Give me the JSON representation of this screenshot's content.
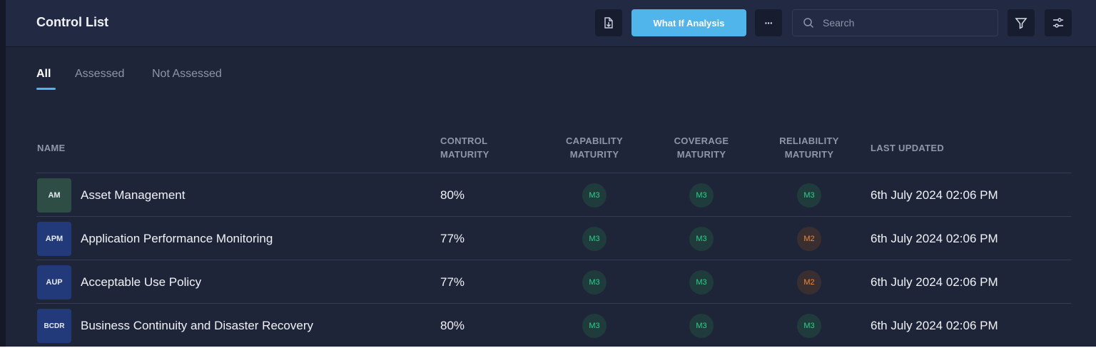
{
  "header": {
    "title": "Control List",
    "what_if_label": "What If Analysis",
    "more_label": "···",
    "search_placeholder": "Search"
  },
  "tabs": [
    {
      "label": "All",
      "active": true
    },
    {
      "label": "Assessed",
      "active": false
    },
    {
      "label": "Not Assessed",
      "active": false
    }
  ],
  "table": {
    "headers": {
      "name": "NAME",
      "control_maturity": [
        "CONTROL",
        "MATURITY"
      ],
      "capability_maturity": [
        "CAPABILITY",
        "MATURITY"
      ],
      "coverage_maturity": [
        "COVERAGE",
        "MATURITY"
      ],
      "reliability_maturity": [
        "RELIABILITY",
        "MATURITY"
      ],
      "last_updated": "LAST UPDATED"
    },
    "rows": [
      {
        "abbr": "AM",
        "abbr_color": "#2e4d45",
        "name": "Asset Management",
        "control_maturity": "80%",
        "capability": "M3",
        "coverage": "M3",
        "reliability": "M3",
        "last_updated": "6th July 2024 02:06 PM"
      },
      {
        "abbr": "APM",
        "abbr_color": "#233a7a",
        "name": "Application Performance Monitoring",
        "control_maturity": "77%",
        "capability": "M3",
        "coverage": "M3",
        "reliability": "M2",
        "last_updated": "6th July 2024 02:06 PM"
      },
      {
        "abbr": "AUP",
        "abbr_color": "#233a7a",
        "name": "Acceptable Use Policy",
        "control_maturity": "77%",
        "capability": "M3",
        "coverage": "M3",
        "reliability": "M2",
        "last_updated": "6th July 2024 02:06 PM"
      },
      {
        "abbr": "BCDR",
        "abbr_color": "#233a7a",
        "name": "Business Continuity and Disaster Recovery",
        "control_maturity": "80%",
        "capability": "M3",
        "coverage": "M3",
        "reliability": "M3",
        "last_updated": "6th July 2024 02:06 PM"
      }
    ]
  },
  "colors": {
    "accent": "#4fb5ea",
    "badge_m3_text": "#2fd08b",
    "badge_m2_text": "#f0873a"
  },
  "icons": [
    "export-icon",
    "more-icon",
    "search-icon",
    "filter-icon",
    "settings-sliders-icon"
  ]
}
